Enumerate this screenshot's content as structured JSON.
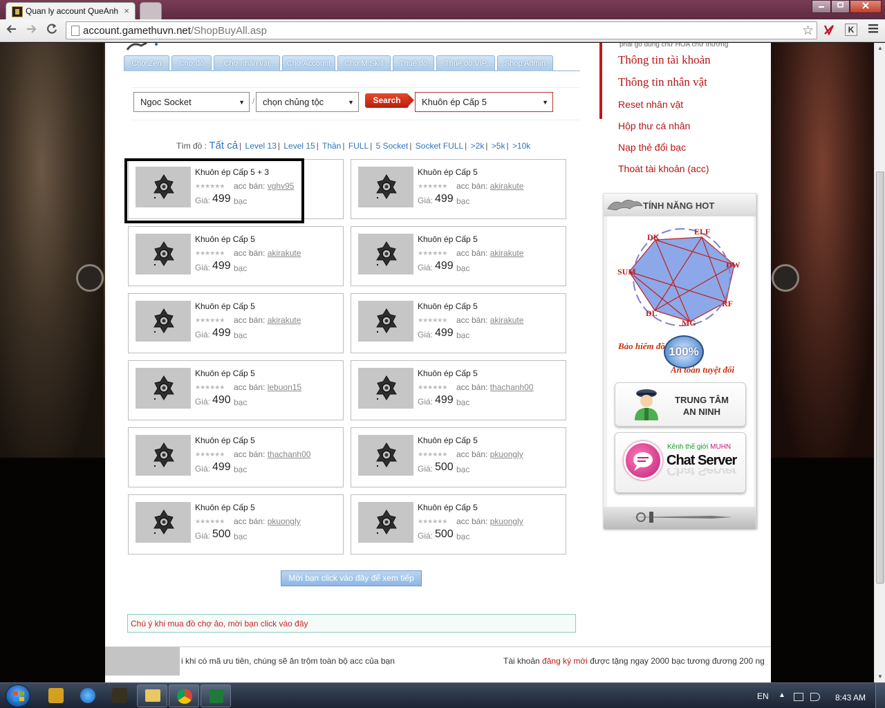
{
  "browser": {
    "tab_title": "Quan ly account QueAnh",
    "tab_close": "×",
    "url_host": "account.gamethuvn.net",
    "url_path": "/ShopBuyAll.asp",
    "ext_k": "K"
  },
  "menu_tabs": [
    "Chợ Zen",
    "Chợ đồ",
    "Chợ nhân vật",
    "Chợ Account",
    "Chợ M.Skill",
    "Thuê đồ",
    "Thuê đồ VIP",
    "Shop Admin"
  ],
  "filter": {
    "type_value": "Ngoc Socket",
    "slash": "/",
    "race_value": "chọn chủng tộc",
    "search_label": "Search",
    "item_value": "Khuôn ép Cấp 5"
  },
  "findby": {
    "label": "Tìm đồ :",
    "links": [
      "Tất cả",
      "Level 13",
      "Level 15",
      "Thần",
      "FULL",
      "5 Socket",
      "Socket FULL",
      ">2k",
      ">5k",
      ">10k"
    ]
  },
  "card_labels": {
    "stars": "★★★★★★",
    "seller_label": "acc bán:",
    "price_label": "Giá:",
    "currency": "bạc"
  },
  "items": [
    {
      "name": "Khuôn ép Cấp 5 + 3",
      "seller": "vghv95",
      "price": "499"
    },
    {
      "name": "Khuôn ép Cấp 5",
      "seller": "akirakute",
      "price": "499"
    },
    {
      "name": "Khuôn ép Cấp 5",
      "seller": "akirakute",
      "price": "499"
    },
    {
      "name": "Khuôn ép Cấp 5",
      "seller": "akirakute",
      "price": "499"
    },
    {
      "name": "Khuôn ép Cấp 5",
      "seller": "akirakute",
      "price": "499"
    },
    {
      "name": "Khuôn ép Cấp 5",
      "seller": "akirakute",
      "price": "499"
    },
    {
      "name": "Khuôn ép Cấp 5",
      "seller": "lebuon15",
      "price": "490"
    },
    {
      "name": "Khuôn ép Cấp 5",
      "seller": "thachanh00",
      "price": "499"
    },
    {
      "name": "Khuôn ép Cấp 5",
      "seller": "thachanh00",
      "price": "499"
    },
    {
      "name": "Khuôn ép Cấp 5",
      "seller": "pkuongly",
      "price": "500"
    },
    {
      "name": "Khuôn ép Cấp 5",
      "seller": "pkuongly",
      "price": "500"
    },
    {
      "name": "Khuôn ép Cấp 5",
      "seller": "pkuongly",
      "price": "500"
    }
  ],
  "more_button": "Mời bạn click vào đây để xem tiếp",
  "notice": "Chú ý khi mua đồ chợ ảo, mời bạn click vào đây",
  "ticker": {
    "left": "i khi có mã ưu tiên, chúng sẽ ăn trộm toàn bộ acc của bạn",
    "right_pre": "Tài khoản ",
    "right_link": "đăng ký mới",
    "right_post": " được tặng ngay 2000 bạc tương đương 200 ng"
  },
  "account_menu": {
    "hint": "phải gõ đúng chữ HOA chữ thường",
    "links": [
      "Thông tin tài khoản",
      "Thông tin nhân vật",
      "Reset nhân vật",
      "Hộp thư cá nhân",
      "Nạp thẻ đổi bạc",
      "Thoát tài khoản (acc)"
    ]
  },
  "hot": {
    "title": "TÍNH NĂNG HOT",
    "classes": [
      "DK",
      "ELF",
      "DW",
      "RF",
      "MG",
      "DL",
      "SUM"
    ],
    "insurance_top": "Bảo hiểm đồ",
    "insurance_pct": "100%",
    "insurance_bottom": "An toàn tuyệt đối",
    "security_line1": "TRUNG TÂM",
    "security_line2": "AN NINH",
    "chat_caption_pre": "Kênh thế giới ",
    "chat_caption_brand": "MUHN",
    "chat_title": "Chat Server"
  },
  "taskbar": {
    "lang": "EN",
    "tray_arrow": "▲",
    "clock": "8:43 AM"
  }
}
